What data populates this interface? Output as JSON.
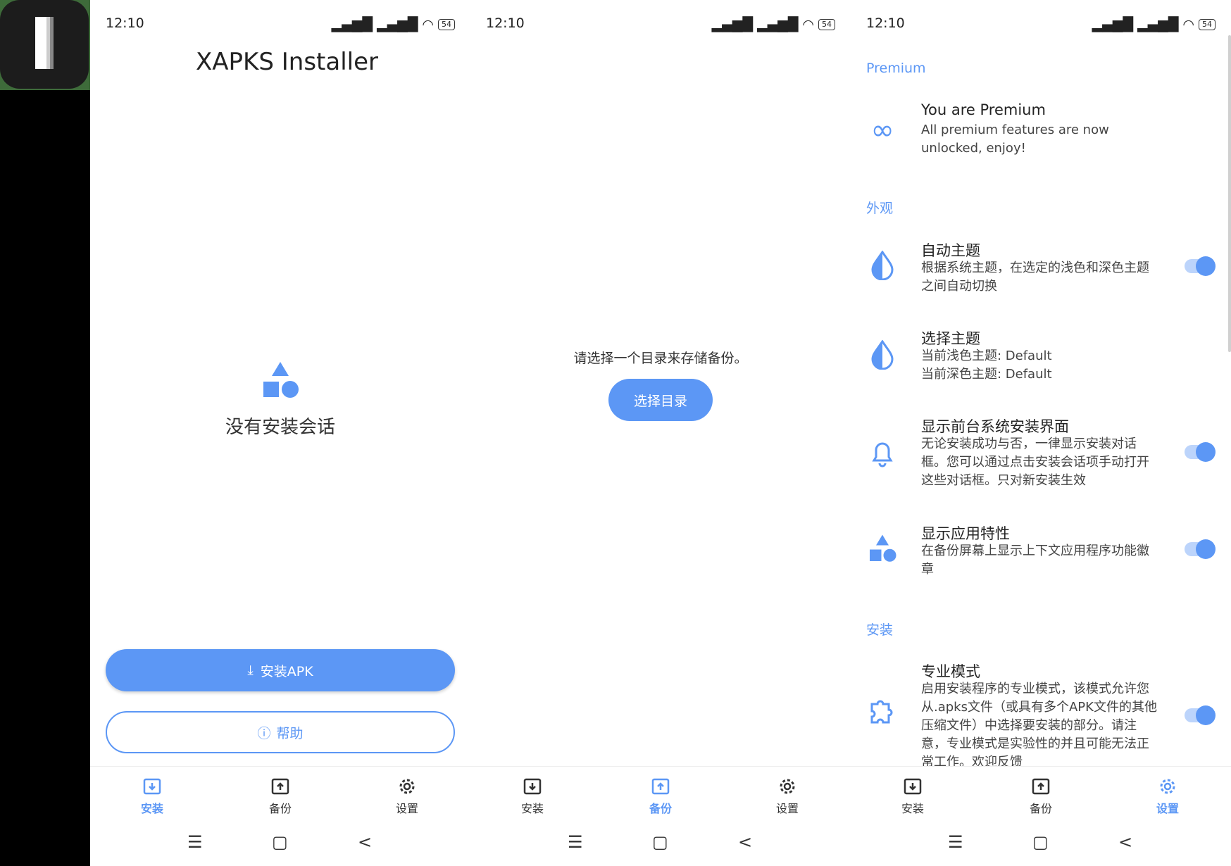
{
  "status": {
    "time": "12:10",
    "battery": "54"
  },
  "screen1": {
    "title": "XAPKS Installer",
    "empty_text": "没有安装会话",
    "install_button": "安装APK",
    "help_button": "帮助"
  },
  "screen2": {
    "prompt": "请选择一个目录来存储备份。",
    "select_button": "选择目录"
  },
  "nav": {
    "install": "安装",
    "backup": "备份",
    "settings": "设置"
  },
  "settings": {
    "premium_section": "Premium",
    "premium_title": "You are Premium",
    "premium_sub": "All premium features are now unlocked, enjoy!",
    "appearance_section": "外观",
    "auto_theme_title": "自动主题",
    "auto_theme_sub": "根据系统主题，在选定的浅色和深色主题之间自动切换",
    "select_theme_title": "选择主题",
    "select_theme_sub1": "当前浅色主题: Default",
    "select_theme_sub2": "当前深色主题: Default",
    "show_ui_title": "显示前台系统安装界面",
    "show_ui_sub": "无论安装成功与否，一律显示安装对话框。您可以通过点击安装会话项手动打开这些对话框。只对新安装生效",
    "show_features_title": "显示应用特性",
    "show_features_sub": "在备份屏幕上显示上下文应用程序功能徽章",
    "install_section": "安装",
    "pro_mode_title": "专业模式",
    "pro_mode_sub": "启用安装程序的专业模式，该模式允许您从.apks文件（或具有多个APK文件的其他压缩文件）中选择要安装的部分。请注意，专业模式是实验性的并且可能无法正常工作。欢迎反馈",
    "toggles": {
      "auto_theme": true,
      "show_ui": true,
      "show_features": true,
      "pro_mode": true
    }
  },
  "colors": {
    "accent": "#5c97f5"
  }
}
